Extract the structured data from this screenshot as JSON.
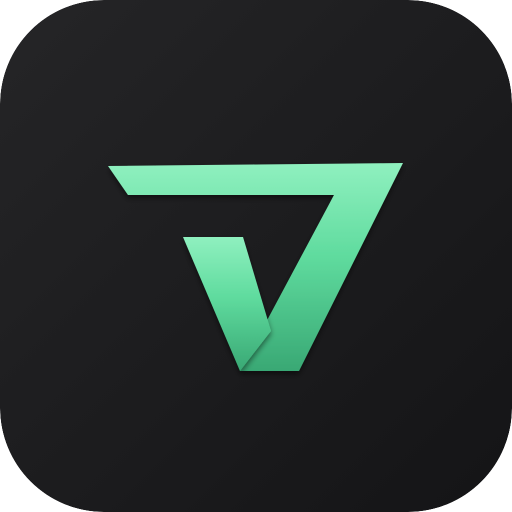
{
  "app_icon": {
    "logo": "stylized-v-checkmark-icon",
    "colors": {
      "background_light": "#252527",
      "background_dark": "#141416",
      "accent": "#5fdb9e",
      "accent_highlight": "#8ff0bf",
      "accent_shadow": "#39a874"
    }
  }
}
